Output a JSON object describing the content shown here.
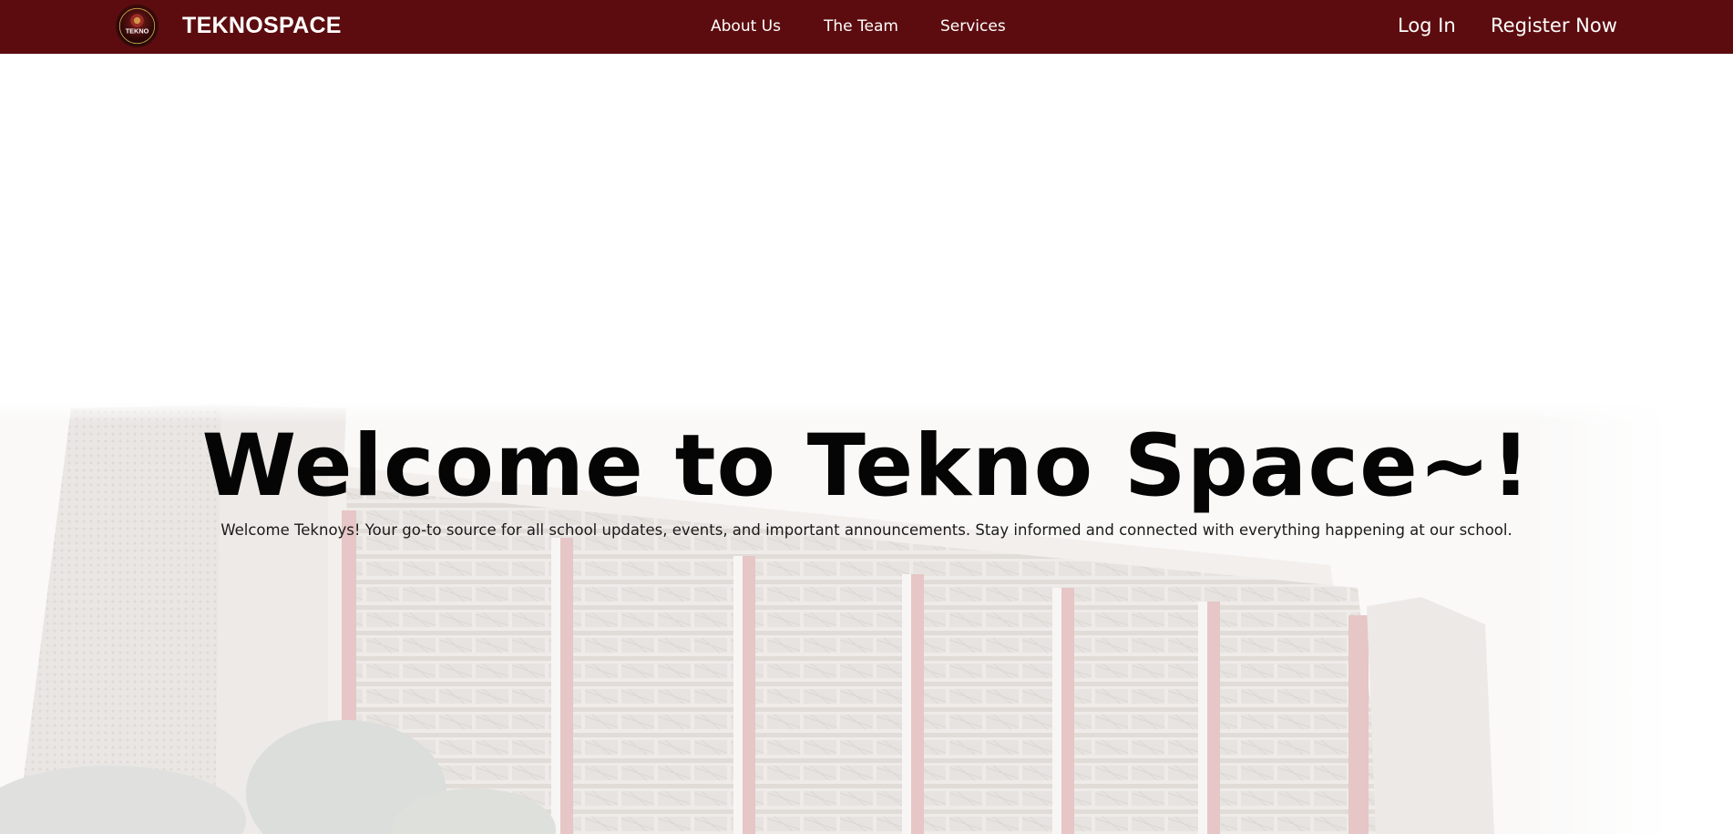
{
  "header": {
    "brand": "TEKNOSPACE",
    "logo_text": "TEKNO",
    "nav": {
      "about": "About Us",
      "team": "The Team",
      "services": "Services"
    },
    "auth": {
      "login": "Log In",
      "register": "Register Now"
    }
  },
  "hero": {
    "title": "Welcome to Tekno Space~!",
    "subtitle": "Welcome Teknoys! Your go-to source for all school updates, events, and important announcements. Stay informed and connected with everything happening at our school."
  },
  "colors": {
    "navbar": "#5c0c0f",
    "nav_text": "#ffffff",
    "title": "#050505"
  }
}
